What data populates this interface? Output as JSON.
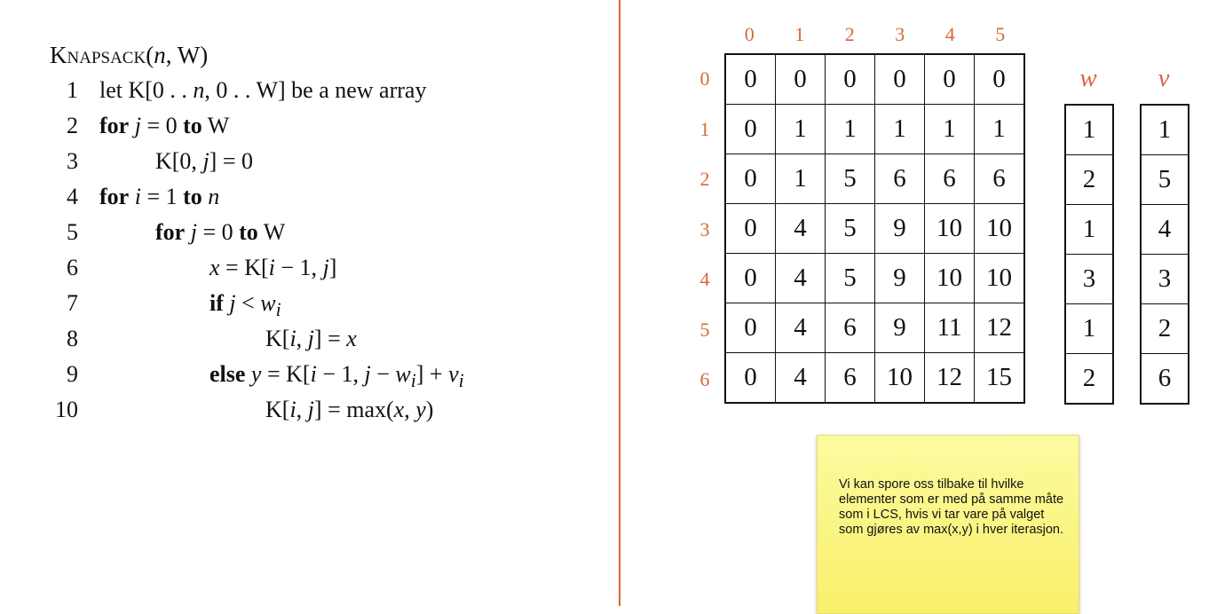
{
  "algorithm": {
    "name": "Knapsack",
    "params": "(n, W)",
    "lines": [
      {
        "num": "1",
        "text": "let K[0 . . n, 0 . . W] be a new array"
      },
      {
        "num": "2",
        "text": "for j = 0 to W"
      },
      {
        "num": "3",
        "text": "K[0, j] = 0"
      },
      {
        "num": "4",
        "text": "for i = 1 to n"
      },
      {
        "num": "5",
        "text": "for j = 0 to W"
      },
      {
        "num": "6",
        "text": "x = K[i − 1, j]"
      },
      {
        "num": "7",
        "text": "if j < wi"
      },
      {
        "num": "8",
        "text": "K[i, j] = x"
      },
      {
        "num": "9",
        "text": "else y = K[i − 1, j − wi] + vi"
      },
      {
        "num": "10",
        "text": "K[i, j] = max(x, y)"
      }
    ]
  },
  "table": {
    "col_indices": [
      "0",
      "1",
      "2",
      "3",
      "4",
      "5"
    ],
    "row_indices": [
      "0",
      "1",
      "2",
      "3",
      "4",
      "5",
      "6"
    ],
    "rows": [
      [
        "0",
        "0",
        "0",
        "0",
        "0",
        "0"
      ],
      [
        "0",
        "1",
        "1",
        "1",
        "1",
        "1"
      ],
      [
        "0",
        "1",
        "5",
        "6",
        "6",
        "6"
      ],
      [
        "0",
        "4",
        "5",
        "9",
        "10",
        "10"
      ],
      [
        "0",
        "4",
        "5",
        "9",
        "10",
        "10"
      ],
      [
        "0",
        "4",
        "6",
        "9",
        "11",
        "12"
      ],
      [
        "0",
        "4",
        "6",
        "10",
        "12",
        "15"
      ]
    ]
  },
  "weights": {
    "header": "w",
    "values": [
      "1",
      "2",
      "1",
      "3",
      "1",
      "2"
    ]
  },
  "item_values": {
    "header": "v",
    "values": [
      "1",
      "5",
      "4",
      "3",
      "2",
      "6"
    ]
  },
  "note": {
    "text": "Vi kan spore oss tilbake til hvilke elementer som er med på samme måte som i LCS, hvis vi tar vare på valget som gjøres av max(x,y) i hver iterasjon."
  },
  "colors": {
    "accent": "#d8673a",
    "note_bg": "#fcf68a"
  }
}
